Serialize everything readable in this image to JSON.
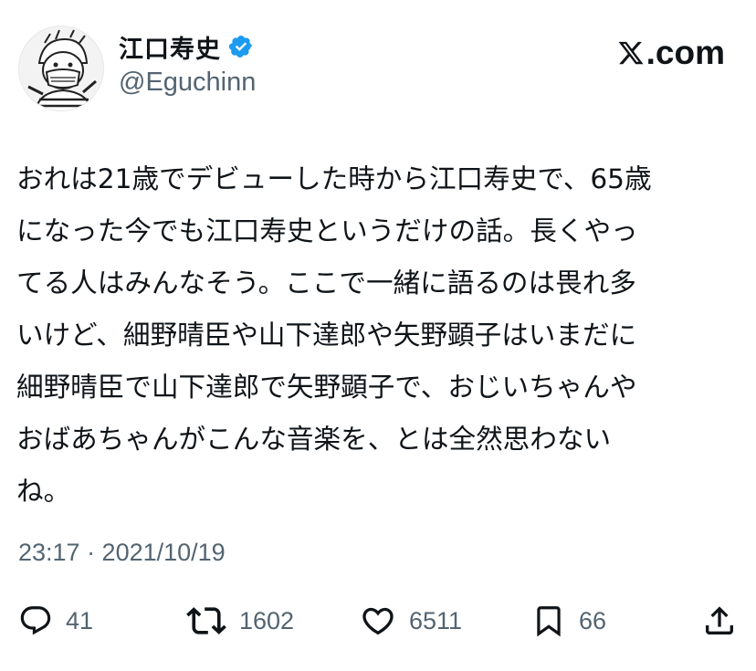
{
  "author": {
    "display_name": "江口寿史",
    "handle": "@Eguchinn",
    "verified": true,
    "avatar_icon": "cartoon-avatar"
  },
  "brand": {
    "label": ".com",
    "icon": "x-logo-icon"
  },
  "tweet": {
    "lines": [
      "おれは21歳でデビューした時から江口寿史で、65歳",
      "になった今でも江口寿史というだけの話。長くやっ",
      "てる人はみんなそう。ここで一緒に語るのは畏れ多",
      "いけど、細野晴臣や山下達郎や矢野顕子はいまだに",
      "細野晴臣で山下達郎で矢野顕子で、おじいちゃんや",
      "おばあちゃんがこんな音楽を、とは全然思わない",
      "ね。"
    ],
    "timestamp": "23:17 · 2021/10/19"
  },
  "actions": {
    "reply_count": "41",
    "retweet_count": "1602",
    "like_count": "6511",
    "bookmark_count": "66"
  },
  "colors": {
    "text": "#0f1419",
    "muted": "#536471",
    "verified": "#1d9bf0"
  }
}
